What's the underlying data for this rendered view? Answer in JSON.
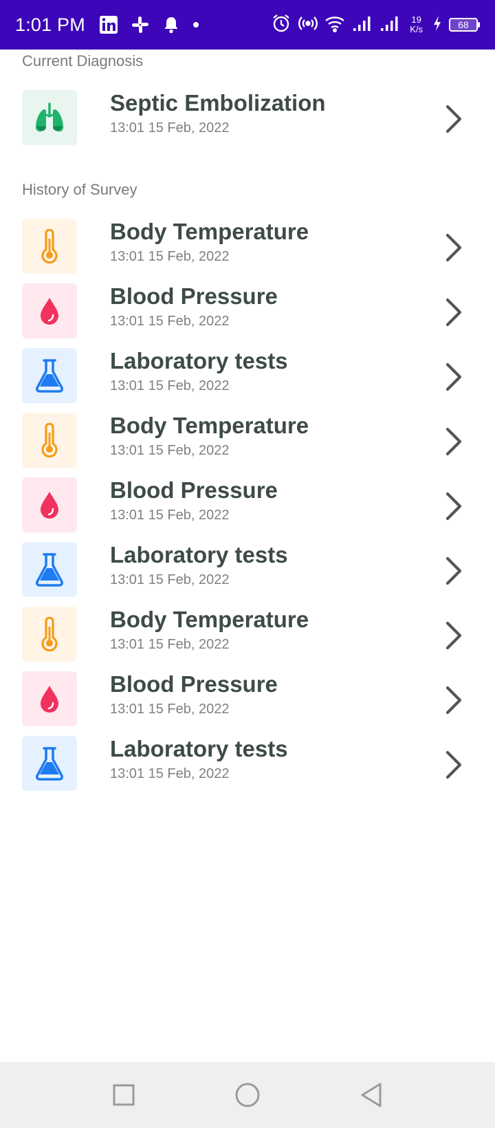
{
  "status_bar": {
    "time": "1:01 PM",
    "notification_icons": [
      "linkedin-icon",
      "slack-icon",
      "bell-icon",
      "dot-icon"
    ],
    "status_icons": [
      "alarm-icon",
      "hotspot-icon",
      "wifi-icon",
      "signal-icon",
      "signal-icon"
    ],
    "net_speed_value": "19",
    "net_speed_unit": "K/s",
    "battery_level": "68",
    "bg_color": "#3d06b8"
  },
  "current_diagnosis": {
    "section_title": "Current Diagnosis",
    "item": {
      "icon": "lungs-icon",
      "title": "Septic Embolization",
      "timestamp": "13:01 15 Feb, 2022"
    }
  },
  "history": {
    "section_title": "History of Survey",
    "items": [
      {
        "icon": "thermometer-icon",
        "title": "Body Temperature",
        "timestamp": "13:01 15 Feb, 2022"
      },
      {
        "icon": "blood-drop-icon",
        "title": "Blood Pressure",
        "timestamp": "13:01 15 Feb, 2022"
      },
      {
        "icon": "flask-icon",
        "title": "Laboratory tests",
        "timestamp": "13:01 15 Feb, 2022"
      },
      {
        "icon": "thermometer-icon",
        "title": "Body Temperature",
        "timestamp": "13:01 15 Feb, 2022"
      },
      {
        "icon": "blood-drop-icon",
        "title": "Blood Pressure",
        "timestamp": "13:01 15 Feb, 2022"
      },
      {
        "icon": "flask-icon",
        "title": "Laboratory tests",
        "timestamp": "13:01 15 Feb, 2022"
      },
      {
        "icon": "thermometer-icon",
        "title": "Body Temperature",
        "timestamp": "13:01 15 Feb, 2022"
      },
      {
        "icon": "blood-drop-icon",
        "title": "Blood Pressure",
        "timestamp": "13:01 15 Feb, 2022"
      },
      {
        "icon": "flask-icon",
        "title": "Laboratory tests",
        "timestamp": "13:01 15 Feb, 2022"
      }
    ]
  },
  "colors": {
    "title_text": "#3e4b47",
    "subtitle_text": "#808080",
    "lungs_tile": "#e8f6ef",
    "lungs_icon": "#1fb36b",
    "thermometer_tile": "#fff4e6",
    "thermometer_icon": "#f59c1a",
    "blood_tile": "#ffe8ee",
    "blood_icon": "#f0325f",
    "flask_tile": "#e6f1ff",
    "flask_icon": "#1e7bf0"
  },
  "nav_bar": {
    "buttons": [
      "recents-square-icon",
      "home-circle-icon",
      "back-triangle-icon"
    ]
  }
}
